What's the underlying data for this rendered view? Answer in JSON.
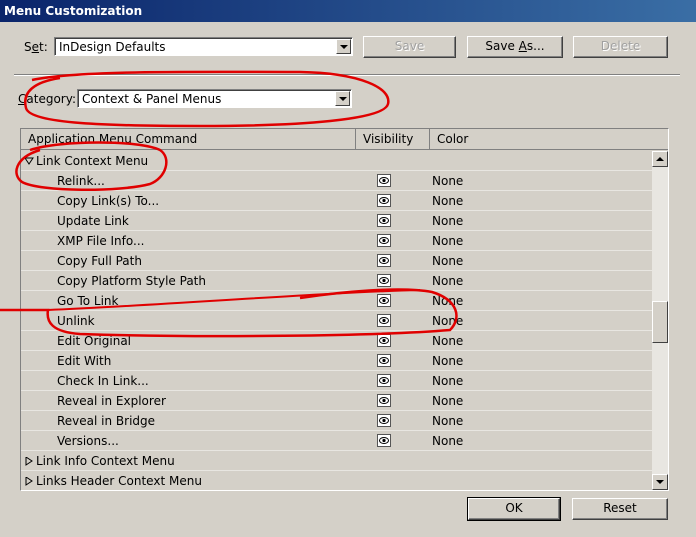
{
  "window": {
    "title": "Menu Customization"
  },
  "set": {
    "label_pre": "S",
    "label_u": "e",
    "label_post": "t:",
    "value": "InDesign Defaults"
  },
  "buttons": {
    "save": "Save",
    "save_as_pre": "Save ",
    "save_as_u": "A",
    "save_as_post": "s...",
    "delete": "Delete",
    "ok": "OK",
    "reset": "Reset"
  },
  "category": {
    "label_u": "C",
    "label_post": "ategory:",
    "value": "Context & Panel Menus"
  },
  "columns": {
    "command": "Application Menu Command",
    "visibility": "Visibility",
    "color": "Color"
  },
  "rows": [
    {
      "label": "Link Context Menu",
      "type": "group",
      "expanded": true
    },
    {
      "label": "Relink...",
      "color": "None"
    },
    {
      "label": "Copy Link(s) To...",
      "color": "None"
    },
    {
      "label": "Update Link",
      "color": "None"
    },
    {
      "label": "XMP File Info...",
      "color": "None"
    },
    {
      "label": "Copy Full Path",
      "color": "None"
    },
    {
      "label": "Copy Platform Style Path",
      "color": "None"
    },
    {
      "label": "Go To Link",
      "color": "None"
    },
    {
      "label": "Unlink",
      "color": "None"
    },
    {
      "label": "Edit Original",
      "color": "None"
    },
    {
      "label": "Edit With",
      "color": "None"
    },
    {
      "label": "Check In Link...",
      "color": "None"
    },
    {
      "label": "Reveal in Explorer",
      "color": "None"
    },
    {
      "label": "Reveal in Bridge",
      "color": "None"
    },
    {
      "label": "Versions...",
      "color": "None"
    },
    {
      "label": "Link Info Context Menu",
      "type": "group",
      "expanded": false
    },
    {
      "label": "Links Header Context Menu",
      "type": "group",
      "expanded": false
    }
  ],
  "icons": {
    "visibility": "eye-icon",
    "expanded": "triangle-down-icon",
    "collapsed": "triangle-right-icon"
  },
  "colors": {
    "annotation": "#e00000",
    "titlebar_start": "#0a246a",
    "titlebar_end": "#3a6ea5"
  }
}
